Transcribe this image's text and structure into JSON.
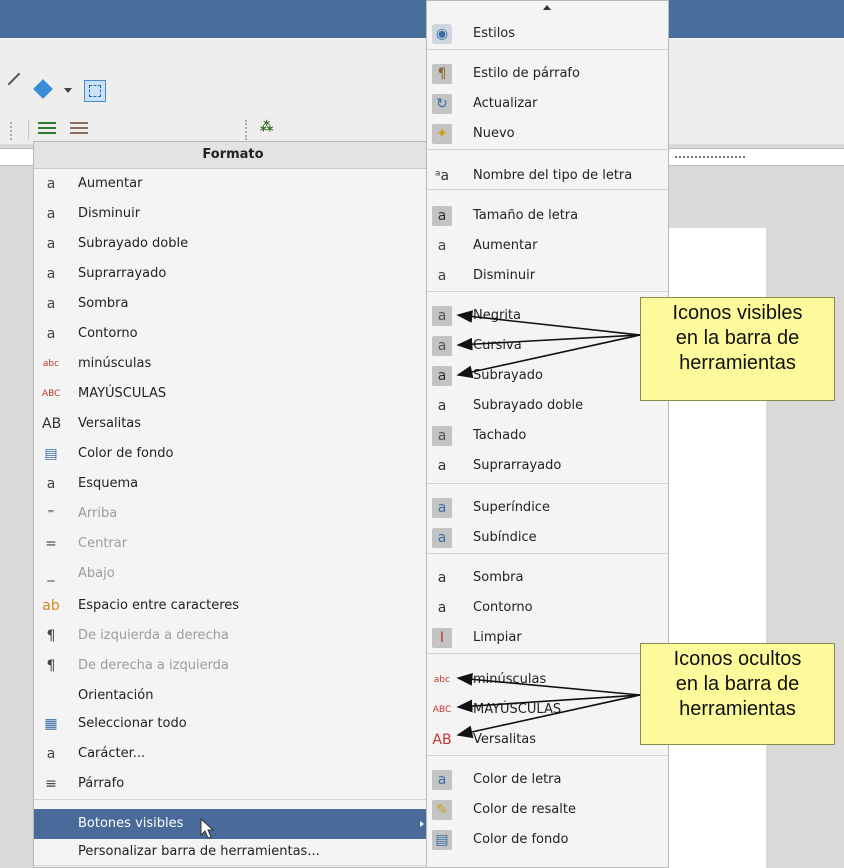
{
  "left_menu": {
    "title": "Formato",
    "items": [
      {
        "label": "Aumentar",
        "icon": "font-grow-icon",
        "glyph": "a",
        "disabled": false
      },
      {
        "label": "Disminuir",
        "icon": "font-shrink-icon",
        "glyph": "a",
        "disabled": false
      },
      {
        "label": "Subrayado doble",
        "icon": "double-underline-icon",
        "glyph": "a",
        "disabled": false
      },
      {
        "label": "Suprarrayado",
        "icon": "overline-icon",
        "glyph": "a",
        "disabled": false
      },
      {
        "label": "Sombra",
        "icon": "shadow-icon",
        "glyph": "a",
        "disabled": false
      },
      {
        "label": "Contorno",
        "icon": "outline-icon",
        "glyph": "a",
        "disabled": false
      },
      {
        "label": "minúsculas",
        "icon": "lowercase-icon",
        "glyph": "abc",
        "disabled": false
      },
      {
        "label": "MAYÚSCULAS",
        "icon": "uppercase-icon",
        "glyph": "ABC",
        "disabled": false
      },
      {
        "label": "Versalitas",
        "icon": "small-caps-icon",
        "glyph": "AB",
        "disabled": false
      },
      {
        "label": "Color de fondo",
        "icon": "background-color-icon",
        "glyph": "▤",
        "disabled": false
      },
      {
        "label": "Esquema",
        "icon": "scheme-icon",
        "glyph": "a",
        "disabled": false
      },
      {
        "label": "Arriba",
        "icon": "align-top-icon",
        "glyph": "⁼",
        "disabled": true
      },
      {
        "label": "Centrar",
        "icon": "align-center-icon",
        "glyph": "=",
        "disabled": true
      },
      {
        "label": "Abajo",
        "icon": "align-bottom-icon",
        "glyph": "_",
        "disabled": true
      },
      {
        "label": "Espacio entre caracteres",
        "icon": "char-spacing-icon",
        "glyph": "ab",
        "disabled": false
      },
      {
        "label": "De izquierda a derecha",
        "icon": "ltr-icon",
        "glyph": "¶",
        "disabled": true
      },
      {
        "label": "De derecha a izquierda",
        "icon": "rtl-icon",
        "glyph": "¶",
        "disabled": true
      },
      {
        "label": "Orientación",
        "icon": "",
        "glyph": "",
        "disabled": false
      },
      {
        "label": "Seleccionar todo",
        "icon": "select-all-icon",
        "glyph": "▦",
        "disabled": false
      },
      {
        "label": "Carácter...",
        "icon": "character-icon",
        "glyph": "a",
        "disabled": false
      },
      {
        "label": "Párrafo",
        "icon": "paragraph-icon",
        "glyph": "≡",
        "disabled": false
      },
      {
        "label": "Botones visibles",
        "icon": "",
        "glyph": "",
        "disabled": false
      },
      {
        "label": "Personalizar barra de herramientas...",
        "icon": "",
        "glyph": "",
        "disabled": false
      }
    ]
  },
  "right_menu": {
    "items": [
      {
        "label": "Estilos",
        "icon": "styles-icon",
        "glyph": "◉"
      },
      {
        "label": "Estilo de párrafo",
        "icon": "paragraph-style-icon",
        "glyph": "¶"
      },
      {
        "label": "Actualizar",
        "icon": "update-style-icon",
        "glyph": "↻"
      },
      {
        "label": "Nuevo",
        "icon": "new-style-icon",
        "glyph": "✦"
      },
      {
        "label": "Nombre del tipo de letra",
        "icon": "font-name-icon",
        "glyph": "ᵃa"
      },
      {
        "label": "Tamaño de letra",
        "icon": "font-size-icon",
        "glyph": "a"
      },
      {
        "label": "Aumentar",
        "icon": "font-grow-icon",
        "glyph": "a"
      },
      {
        "label": "Disminuir",
        "icon": "font-shrink-icon",
        "glyph": "a"
      },
      {
        "label": "Negrita",
        "icon": "bold-icon",
        "glyph": "a"
      },
      {
        "label": "Cursiva",
        "icon": "italic-icon",
        "glyph": "a"
      },
      {
        "label": "Subrayado",
        "icon": "underline-icon",
        "glyph": "a"
      },
      {
        "label": "Subrayado doble",
        "icon": "double-underline-icon",
        "glyph": "a"
      },
      {
        "label": "Tachado",
        "icon": "strikethrough-icon",
        "glyph": "a"
      },
      {
        "label": "Suprarrayado",
        "icon": "overline-icon",
        "glyph": "a"
      },
      {
        "label": "Superíndice",
        "icon": "superscript-icon",
        "glyph": "a"
      },
      {
        "label": "Subíndice",
        "icon": "subscript-icon",
        "glyph": "a"
      },
      {
        "label": "Sombra",
        "icon": "shadow-icon",
        "glyph": "a"
      },
      {
        "label": "Contorno",
        "icon": "outline-icon",
        "glyph": "a"
      },
      {
        "label": "Limpiar",
        "icon": "clear-formatting-icon",
        "glyph": "I"
      },
      {
        "label": "minúsculas",
        "icon": "lowercase-icon",
        "glyph": "abc"
      },
      {
        "label": "MAYÚSCULAS",
        "icon": "uppercase-icon",
        "glyph": "ABC"
      },
      {
        "label": "Versalitas",
        "icon": "small-caps-icon",
        "glyph": "AB"
      },
      {
        "label": "Color de letra",
        "icon": "font-color-icon",
        "glyph": "a"
      },
      {
        "label": "Color de resalte",
        "icon": "highlight-color-icon",
        "glyph": "✎"
      },
      {
        "label": "Color de fondo",
        "icon": "background-color-icon",
        "glyph": "▤"
      }
    ]
  },
  "callouts": {
    "visible": {
      "line1": "Iconos visibles",
      "line2": "en la barra de",
      "line3": "herramientas"
    },
    "hidden": {
      "line1": "Iconos ocultos",
      "line2": "en la barra de",
      "line3": "herramientas"
    }
  },
  "toolbar": {
    "find_icon_glyph": "⁂"
  },
  "colors": {
    "titlebar": "#4a6e9c",
    "menu_highlight": "#4a6a9a",
    "callout_fill": "#fdfa9b"
  }
}
